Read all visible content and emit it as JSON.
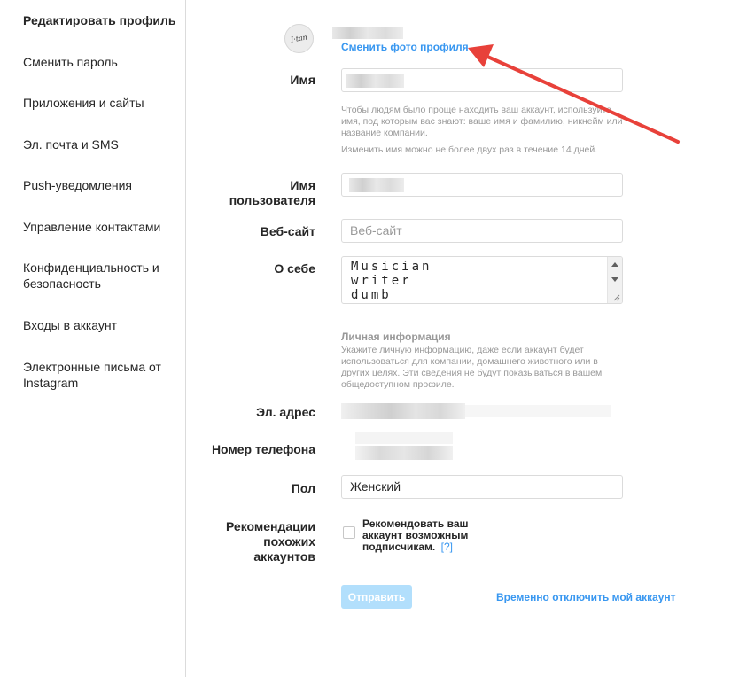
{
  "sidebar": {
    "items": [
      {
        "label": "Редактировать профиль"
      },
      {
        "label": "Сменить пароль"
      },
      {
        "label": "Приложения и сайты"
      },
      {
        "label": "Эл. почта и SMS"
      },
      {
        "label": "Push-уведомления"
      },
      {
        "label": "Управление контактами"
      },
      {
        "label": "Конфиденциальность и безопасность"
      },
      {
        "label": "Входы в аккаунт"
      },
      {
        "label": "Электронные письма от Instagram"
      }
    ]
  },
  "profile": {
    "change_photo": "Сменить фото профиля"
  },
  "form": {
    "name_label": "Имя",
    "name_hint": "Чтобы людям было проще находить ваш аккаунт, используйте имя, под которым вас знают: ваше имя и фамилию, никнейм или название компании.",
    "name_limit_hint": "Изменить имя можно не более двух раз в течение 14 дней.",
    "username_label": "Имя пользователя",
    "website_label": "Веб-сайт",
    "website_placeholder": "Веб-сайт",
    "bio_label": "О себе",
    "bio_value": "Musician\nwriter\ndumb",
    "personal_info_title": "Личная информация",
    "personal_info_hint": "Укажите личную информацию, даже если аккаунт будет использоваться для компании, домашнего животного или в других целях. Эти сведения не будут показываться в вашем общедоступном профиле.",
    "email_label": "Эл. адрес",
    "phone_label": "Номер телефона",
    "gender_label": "Пол",
    "gender_value": "Женский",
    "recommend_label": "Рекомендации похожих аккаунтов",
    "recommend_checkbox_text": "Рекомендовать ваш аккаунт возможным подписчикам.",
    "recommend_help": "[?]",
    "recommend_checked": false,
    "submit_label": "Отправить",
    "disable_account": "Временно отключить мой аккаунт"
  },
  "colors": {
    "link": "#3897f0",
    "submit_disabled": "#b2dffc",
    "annotation_arrow": "#e8413a"
  }
}
